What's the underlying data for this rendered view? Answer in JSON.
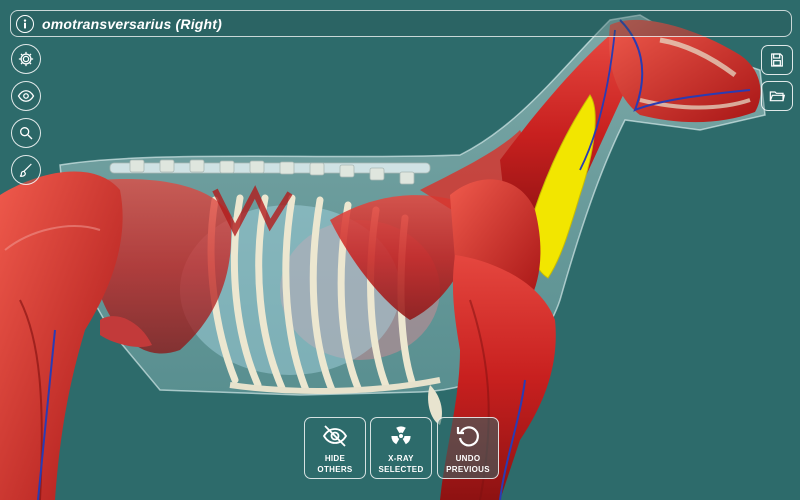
{
  "header": {
    "title": "omotransversarius (Right)"
  },
  "left_toolbar": [
    {
      "icon": "gear-icon"
    },
    {
      "icon": "eye-icon"
    },
    {
      "icon": "search-icon"
    },
    {
      "icon": "brush-icon"
    }
  ],
  "right_toolbar": [
    {
      "icon": "save-icon"
    },
    {
      "icon": "folder-icon"
    }
  ],
  "bottom_actions": {
    "hide_others_line1": "HIDE",
    "hide_others_line2": "OTHERS",
    "xray_line1": "X-RAY",
    "xray_line2": "SELECTED",
    "undo_line1": "UNDO",
    "undo_line2": "PREVIOUS"
  },
  "colors": {
    "background": "#2d6b6b",
    "muscle": "#c81e1e",
    "selected_muscle": "#f2e600",
    "bone": "#e8e4cf"
  }
}
